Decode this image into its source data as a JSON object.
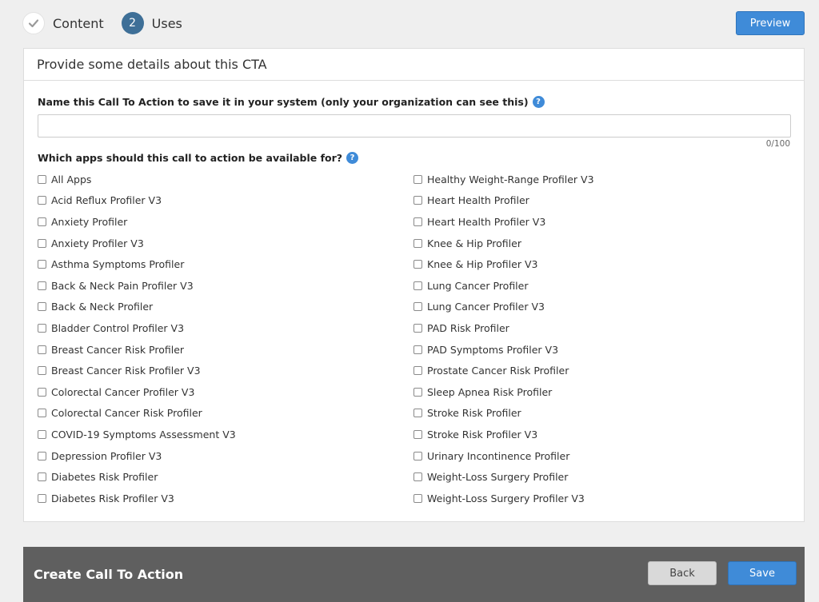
{
  "stepper": {
    "steps": [
      {
        "number": "",
        "label": "Content",
        "state": "done"
      },
      {
        "number": "2",
        "label": "Uses",
        "state": "current"
      }
    ]
  },
  "header": {
    "preview_label": "Preview"
  },
  "card": {
    "title": "Provide some details about this CTA",
    "name_field": {
      "label": "Name this Call To Action to save it in your system (only your organization can see this)",
      "value": "",
      "placeholder": "",
      "char_count": "0/100"
    },
    "apps": {
      "label": "Which apps should this call to action be available for?",
      "left": [
        "All Apps",
        "Acid Reflux Profiler V3",
        "Anxiety Profiler",
        "Anxiety Profiler V3",
        "Asthma Symptoms Profiler",
        "Back & Neck Pain Profiler V3",
        "Back & Neck Profiler",
        "Bladder Control Profiler V3",
        "Breast Cancer Risk Profiler",
        "Breast Cancer Risk Profiler V3",
        "Colorectal Cancer Profiler V3",
        "Colorectal Cancer Risk Profiler",
        "COVID-19 Symptoms Assessment V3",
        "Depression Profiler V3",
        "Diabetes Risk Profiler",
        "Diabetes Risk Profiler V3"
      ],
      "right": [
        "Healthy Weight-Range Profiler V3",
        "Heart Health Profiler",
        "Heart Health Profiler V3",
        "Knee & Hip Profiler",
        "Knee & Hip Profiler V3",
        "Lung Cancer Profiler",
        "Lung Cancer Profiler V3",
        "PAD Risk Profiler",
        "PAD Symptoms Profiler V3",
        "Prostate Cancer Risk Profiler",
        "Sleep Apnea Risk Profiler",
        "Stroke Risk Profiler",
        "Stroke Risk Profiler V3",
        "Urinary Incontinence Profiler",
        "Weight-Loss Surgery Profiler",
        "Weight-Loss Surgery Profiler V3"
      ]
    }
  },
  "footer": {
    "title": "Create Call To Action",
    "back_label": "Back",
    "save_label": "Save"
  },
  "icons": {
    "step_done": "checkmark-icon",
    "help": "help-icon"
  },
  "colors": {
    "primary": "#3f8bd8",
    "step_current": "#3e6f97",
    "footer_bg": "#5f5f5f"
  }
}
